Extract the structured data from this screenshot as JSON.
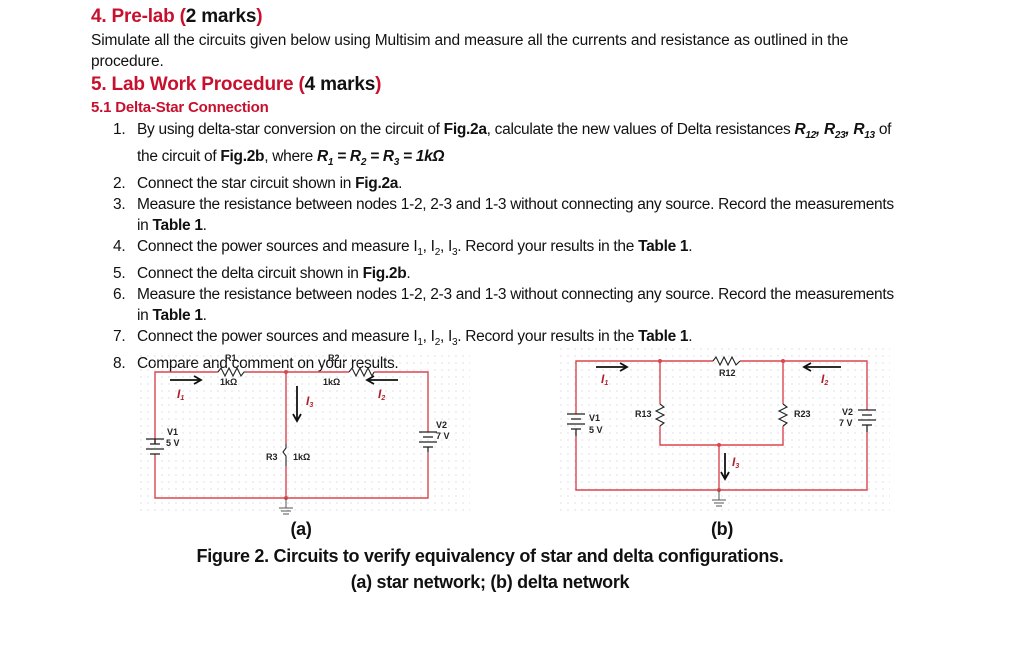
{
  "prelab": {
    "number": "4.",
    "title": "Pre-lab",
    "marks_open": "(",
    "marks": "2 marks",
    "marks_close": ")",
    "text_line1": "Simulate all the circuits given below using Multisim and measure all the currents and resistance as outlined in the",
    "text_line2": "procedure."
  },
  "procedure": {
    "number": "5.",
    "title": "Lab Work Procedure",
    "marks_open": "(",
    "marks": "4 marks",
    "marks_close": ")",
    "subsection": "5.1 Delta-Star Connection"
  },
  "steps": [
    {
      "n": "1.",
      "a": "By using delta-star conversion on the circuit of ",
      "b": "Fig.2a",
      "c": ", calculate the new values of Delta resistances ",
      "r12": "R",
      "r12s": "12",
      "r23": "R",
      "r23s": "23",
      "r13": "R",
      "r13s": "13",
      "d": " of",
      "line2a": "the circuit of ",
      "line2b": "Fig.2b",
      "line2c": ", where ",
      "eq": "R",
      "eq1": "1",
      "eq2": "R",
      "eq2s": "2",
      "eq3": "R",
      "eq3s": "3",
      "eqv": "= 1kΩ"
    },
    {
      "n": "2.",
      "a": "Connect the star circuit shown in ",
      "b": "Fig.2a",
      "c": "."
    },
    {
      "n": "3.",
      "a": "Measure the resistance between nodes 1-2, 2-3 and 1-3 without connecting any source. Record the measurements",
      "line2a": "in ",
      "line2b": "Table 1",
      "line2c": "."
    },
    {
      "n": "4.",
      "a": "Connect the power sources and measure I",
      "s1": "1",
      "s2": "2",
      "s3": "3",
      "c": ". Record your results in the ",
      "b": "Table 1",
      "d": "."
    },
    {
      "n": "5.",
      "a": "Connect the delta circuit shown in ",
      "b": "Fig.2b",
      "c": "."
    },
    {
      "n": "6.",
      "a": "Measure the resistance between nodes 1-2, 2-3 and 1-3 without connecting any source. Record the measurements",
      "line2a": "in ",
      "line2b": "Table 1",
      "line2c": "."
    },
    {
      "n": "7.",
      "a": "Connect the power sources and measure I",
      "s1": "1",
      "s2": "2",
      "s3": "3",
      "c": ". Record your results in the ",
      "b": "Table 1",
      "d": "."
    },
    {
      "n": "8.",
      "a": "Compare and comment on your results."
    }
  ],
  "circuit_a": {
    "r1_label": "R1",
    "r1_value": "1kΩ",
    "r2_label": "R2",
    "r2_value": "1kΩ",
    "r3_label": "R3",
    "r3_value": "1kΩ",
    "v1_label": "V1",
    "v1_value": "5 V",
    "v2_label": "V2",
    "v2_value": "7 V",
    "i1": "I",
    "i1s": "1",
    "i2": "I",
    "i2s": "2",
    "i3": "I",
    "i3s": "3",
    "caption": "(a)"
  },
  "circuit_b": {
    "r12_label": "R12",
    "r13_label": "R13",
    "r23_label": "R23",
    "v1_label": "V1",
    "v1_value": "5 V",
    "v2_label": "V2",
    "v2_value": "7 V",
    "i1": "I",
    "i1s": "1",
    "i2": "I",
    "i2s": "2",
    "i3": "I",
    "i3s": "3",
    "caption": "(b)"
  },
  "figure": {
    "caption_line1": "Figure 2. Circuits to verify equivalency of star and delta configurations.",
    "caption_line2": "(a) star network; (b) delta network"
  },
  "colors": {
    "heading_red": "#c8102e",
    "wire_red": "#d9474f",
    "current_label_red": "#b0202a"
  }
}
